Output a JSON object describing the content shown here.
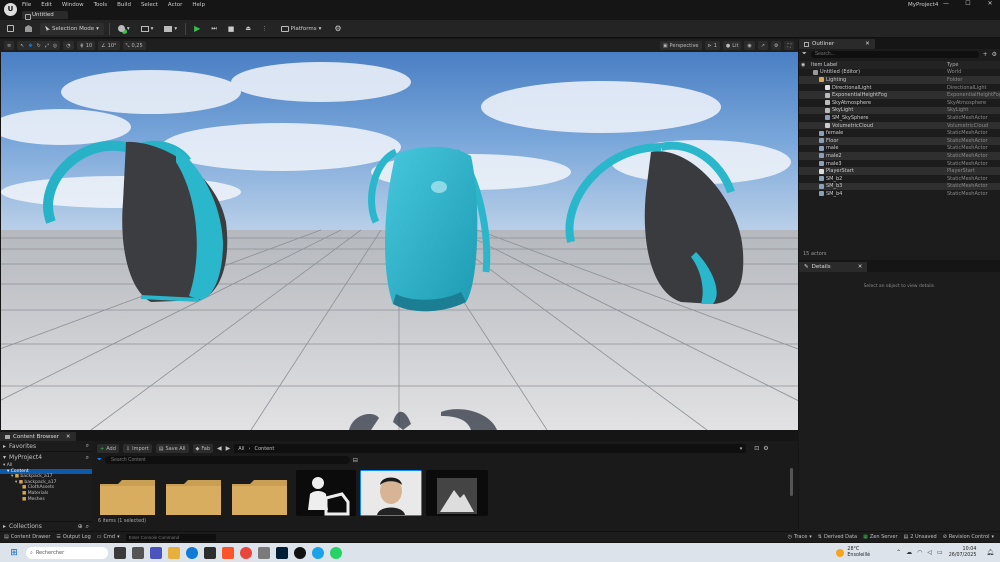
{
  "app": {
    "logo": "U",
    "project_name": "MyProject4",
    "tab": "Untitled"
  },
  "menu": [
    "File",
    "Edit",
    "Window",
    "Tools",
    "Build",
    "Select",
    "Actor",
    "Help"
  ],
  "window_buttons": {
    "minimize": "—",
    "maximize": "☐",
    "close": "✕"
  },
  "toolbar": {
    "selection_mode": "Selection Mode",
    "platforms": "Platforms"
  },
  "viewport_toolbar": {
    "snap_translate": "10",
    "snap_rotate": "10°",
    "snap_scale": "0,25",
    "camera_speed": "1",
    "perspective": "Perspective",
    "lit": "Lit",
    "show": "Show",
    "menu_icon": "≡",
    "play_icon": "▶",
    "pause_icon": "⏸",
    "stop_icon": "■",
    "skip_icon": "⏭"
  },
  "outliner": {
    "title": "Outliner",
    "search_placeholder": "Search...",
    "col_label": "Item Label",
    "col_type": "Type",
    "rows": [
      {
        "label": "Untitled (Editor)",
        "type": "World",
        "indent": 1,
        "icon": "world-icon"
      },
      {
        "label": "Lighting",
        "type": "Folder",
        "indent": 2,
        "icon": "folder-icon"
      },
      {
        "label": "DirectionalLight",
        "type": "DirectionalLight",
        "indent": 3,
        "icon": "light-icon"
      },
      {
        "label": "ExponentialHeightFog",
        "type": "ExponentialHeightFog",
        "indent": 3,
        "icon": "fog-icon"
      },
      {
        "label": "SkyAtmosphere",
        "type": "SkyAtmosphere",
        "indent": 3,
        "icon": "sky-icon"
      },
      {
        "label": "SkyLight",
        "type": "SkyLight",
        "indent": 3,
        "icon": "skylight-icon"
      },
      {
        "label": "SM_SkySphere",
        "type": "StaticMeshActor",
        "indent": 3,
        "icon": "mesh-icon"
      },
      {
        "label": "VolumetricCloud",
        "type": "VolumetricCloud",
        "indent": 3,
        "icon": "cloud-icon"
      },
      {
        "label": "female",
        "type": "StaticMeshActor",
        "indent": 2,
        "icon": "mesh-icon"
      },
      {
        "label": "Floor",
        "type": "StaticMeshActor",
        "indent": 2,
        "icon": "mesh-icon"
      },
      {
        "label": "male",
        "type": "StaticMeshActor",
        "indent": 2,
        "icon": "mesh-icon"
      },
      {
        "label": "male2",
        "type": "StaticMeshActor",
        "indent": 2,
        "icon": "mesh-icon"
      },
      {
        "label": "male3",
        "type": "StaticMeshActor",
        "indent": 2,
        "icon": "mesh-icon"
      },
      {
        "label": "PlayerStart",
        "type": "PlayerStart",
        "indent": 2,
        "icon": "playerstart-icon"
      },
      {
        "label": "SM_b2",
        "type": "StaticMeshActor",
        "indent": 2,
        "icon": "mesh-icon"
      },
      {
        "label": "SM_b3",
        "type": "StaticMeshActor",
        "indent": 2,
        "icon": "mesh-icon"
      },
      {
        "label": "SM_b4",
        "type": "StaticMeshActor",
        "indent": 2,
        "icon": "mesh-icon"
      }
    ],
    "actor_count": "15 actors"
  },
  "details": {
    "title": "Details",
    "empty": "Select an object to view details."
  },
  "content_browser": {
    "title": "Content Browser",
    "add": "Add",
    "import": "Import",
    "save_all": "Save All",
    "fab": "Fab",
    "path_all": "All",
    "path_content": "Content",
    "search_placeholder": "Search Content",
    "favorites": "Favorites",
    "project": "MyProject4",
    "tree": [
      "All",
      "Content",
      "backpack_a17",
      "backpack_a17",
      "ClothAssets",
      "Materials",
      "Meshes"
    ],
    "collections": "Collections",
    "status": "6 items (1 selected)"
  },
  "bottombar": {
    "content_drawer": "Content Drawer",
    "output_log": "Output Log",
    "cmd": "Cmd",
    "console_placeholder": "Enter Console Command",
    "trace": "Trace",
    "derived_data": "Derived Data",
    "zen_server": "Zen Server",
    "unsaved": "2 Unsaved",
    "revision_control": "Revision Control"
  },
  "taskbar": {
    "search_placeholder": "Rechercher",
    "temperature": "28°C",
    "weather": "Ensoleillé",
    "time": "10:04",
    "date": "26/07/2025"
  },
  "colors": {
    "accent": "#0e8bff",
    "play_green": "#36c24a",
    "sky": "#5b8fd1",
    "backpack_teal": "#2ab7cc"
  }
}
